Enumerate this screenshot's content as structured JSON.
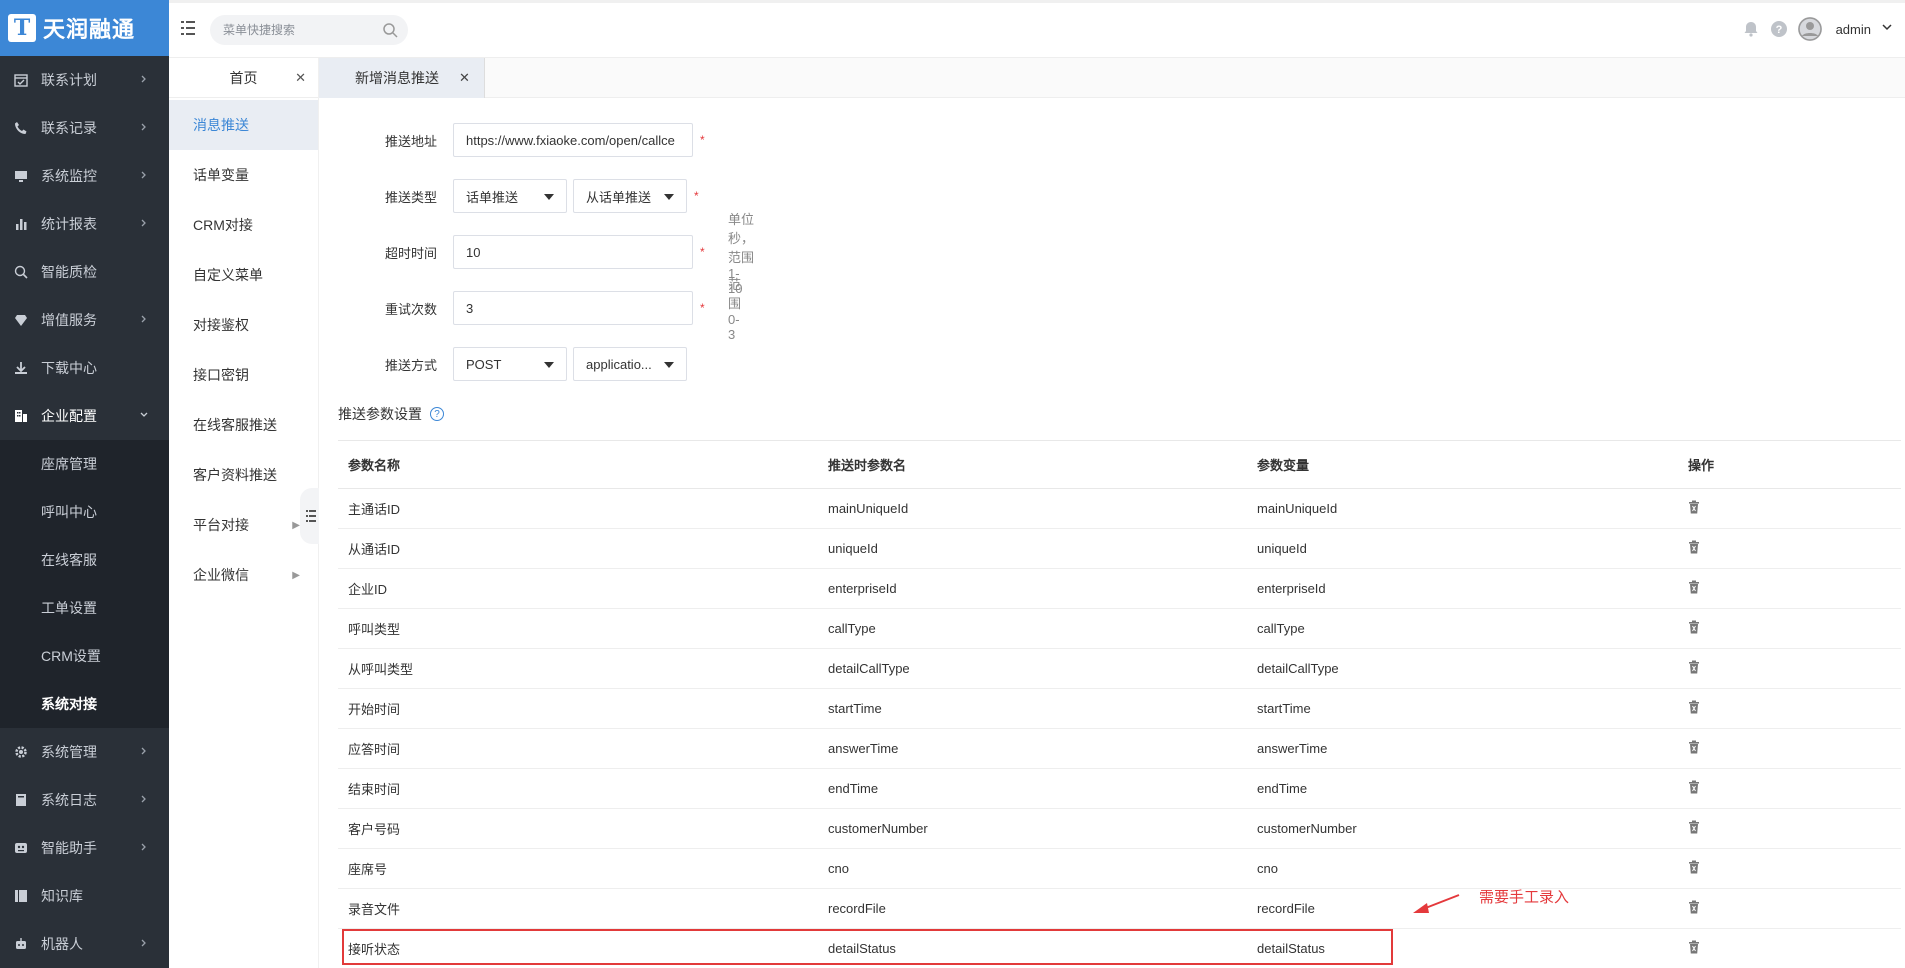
{
  "brand": {
    "logo_letter": "T",
    "name": "天润融通"
  },
  "sidebar": {
    "items": [
      {
        "label": "联系计划",
        "icon": "calendar-check-icon"
      },
      {
        "label": "联系记录",
        "icon": "phone-log-icon"
      },
      {
        "label": "系统监控",
        "icon": "monitor-icon"
      },
      {
        "label": "统计报表",
        "icon": "bar-chart-icon"
      },
      {
        "label": "智能质检",
        "icon": "magnifier-icon"
      },
      {
        "label": "增值服务",
        "icon": "diamond-icon"
      },
      {
        "label": "下载中心",
        "icon": "download-icon"
      },
      {
        "label": "企业配置",
        "icon": "building-icon"
      }
    ],
    "sub_items": [
      "座席管理",
      "呼叫中心",
      "在线客服",
      "工单设置",
      "CRM设置",
      "系统对接"
    ],
    "items_after": [
      {
        "label": "系统管理",
        "icon": "gear-icon"
      },
      {
        "label": "系统日志",
        "icon": "book-icon"
      },
      {
        "label": "智能助手",
        "icon": "robot-face-icon"
      },
      {
        "label": "知识库",
        "icon": "knowledge-book-icon"
      },
      {
        "label": "机器人",
        "icon": "robot-icon"
      }
    ]
  },
  "topbar": {
    "search_placeholder": "菜单快捷搜索",
    "user": "admin"
  },
  "submenu": {
    "home_tab": "首页",
    "items": [
      "消息推送",
      "话单变量",
      "CRM对接",
      "自定义菜单",
      "对接鉴权",
      "接口密钥",
      "在线客服推送",
      "客户资料推送",
      "平台对接",
      "企业微信"
    ]
  },
  "tabs": [
    {
      "label": "新增消息推送"
    }
  ],
  "form": {
    "url_label": "推送地址",
    "url_value": "https://www.fxiaoke.com/open/callce",
    "type_label": "推送类型",
    "type_value_1": "话单推送",
    "type_value_2": "从话单推送",
    "timeout_label": "超时时间",
    "timeout_value": "10",
    "timeout_hint": "单位秒，范围 1-10",
    "retry_label": "重试次数",
    "retry_value": "3",
    "retry_hint": "范围 0-3",
    "method_label": "推送方式",
    "method_value": "POST",
    "content_type_value": "applicatio...",
    "required_mark": "*"
  },
  "params_section_title": "推送参数设置",
  "help_mark": "?",
  "table": {
    "headers": [
      "参数名称",
      "推送时参数名",
      "参数变量",
      "操作"
    ],
    "rows": [
      [
        "主通话ID",
        "mainUniqueId",
        "mainUniqueId"
      ],
      [
        "从通话ID",
        "uniqueId",
        "uniqueId"
      ],
      [
        "企业ID",
        "enterpriseId",
        "enterpriseId"
      ],
      [
        "呼叫类型",
        "callType",
        "callType"
      ],
      [
        "从呼叫类型",
        "detailCallType",
        "detailCallType"
      ],
      [
        "开始时间",
        "startTime",
        "startTime"
      ],
      [
        "应答时间",
        "answerTime",
        "answerTime"
      ],
      [
        "结束时间",
        "endTime",
        "endTime"
      ],
      [
        "客户号码",
        "customerNumber",
        "customerNumber"
      ],
      [
        "座席号",
        "cno",
        "cno"
      ],
      [
        "录音文件",
        "recordFile",
        "recordFile"
      ],
      [
        "接听状态",
        "detailStatus",
        "detailStatus"
      ]
    ]
  },
  "annotation": "需要手工录入",
  "colors": {
    "brand_blue": "#3c87d6",
    "sidebar_bg": "#2a3038",
    "highlight_red": "#e23a3a"
  }
}
